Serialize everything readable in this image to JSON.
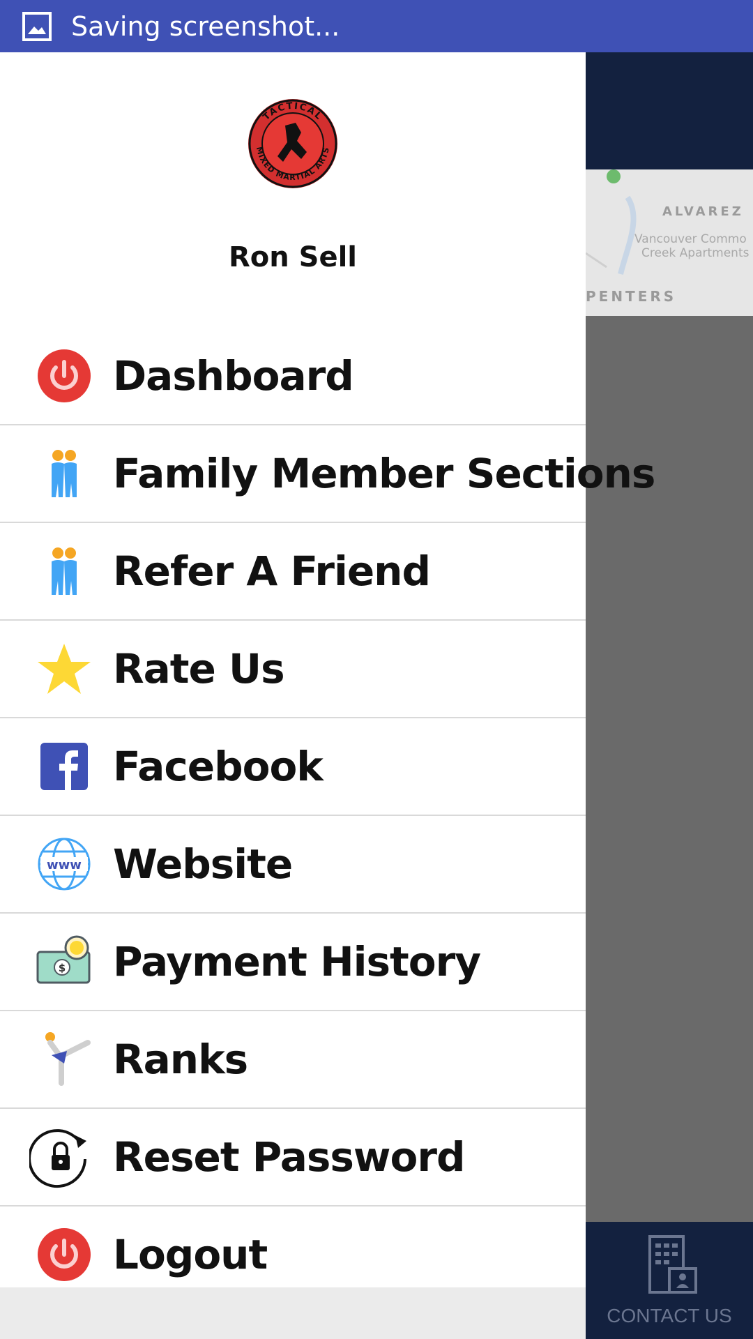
{
  "status_bar": {
    "icon": "image-icon",
    "text": "Saving screenshot..."
  },
  "background_app": {
    "map_labels": [
      "ALVAREZ",
      "PENTERS"
    ],
    "map_small_text": [
      "Vancouver Commo",
      "Creek Apartments"
    ],
    "contact_label": "CONTACT US",
    "colors": {
      "toolbar": "#13213f"
    }
  },
  "drawer": {
    "logo_text": "TACTICAL MIXED MARTIAL ARTS",
    "user_name": "Ron Sell",
    "menu": [
      {
        "label": "Dashboard",
        "icon": "power-icon"
      },
      {
        "label": "Family Member Sections",
        "icon": "people-icon"
      },
      {
        "label": "Refer A Friend",
        "icon": "people-icon"
      },
      {
        "label": "Rate Us",
        "icon": "star-icon"
      },
      {
        "label": "Facebook",
        "icon": "facebook-icon"
      },
      {
        "label": "Website",
        "icon": "globe-www-icon"
      },
      {
        "label": "Payment History",
        "icon": "money-icon"
      },
      {
        "label": "Ranks",
        "icon": "kick-icon"
      },
      {
        "label": "Reset Password",
        "icon": "lock-reset-icon"
      },
      {
        "label": "Logout",
        "icon": "power-icon"
      }
    ]
  },
  "colors": {
    "status_bar": "#3f51b5",
    "power_red": "#e53935",
    "star_yellow": "#fdd835",
    "facebook_blue": "#3f51b5",
    "people_blue": "#42a5f5"
  }
}
